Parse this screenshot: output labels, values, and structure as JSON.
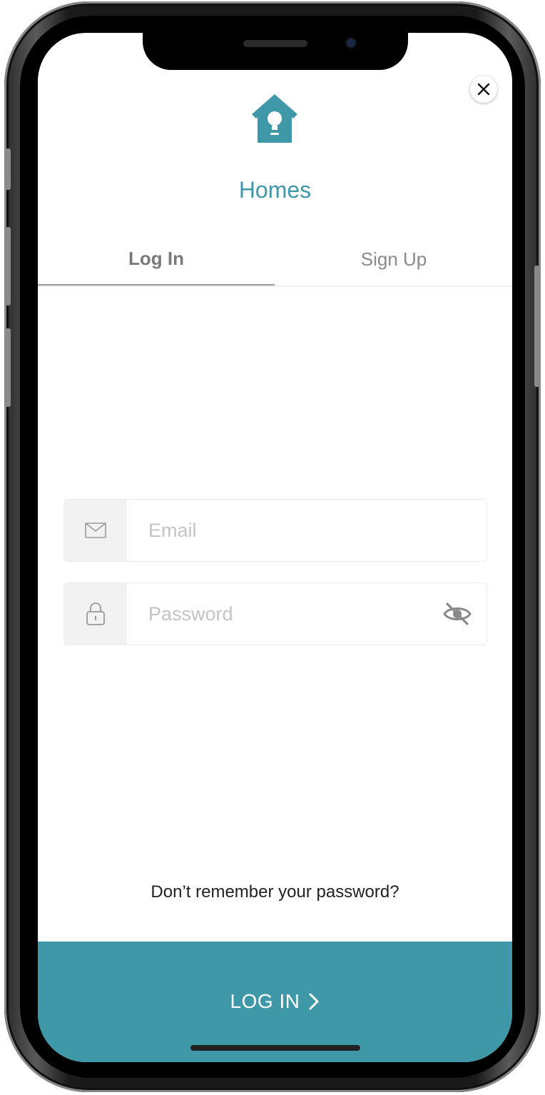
{
  "app": {
    "title": "Homes",
    "accent_color": "#3f98a8"
  },
  "tabs": [
    {
      "label": "Log In",
      "active": true
    },
    {
      "label": "Sign Up",
      "active": false
    }
  ],
  "form": {
    "email": {
      "placeholder": "Email",
      "value": "",
      "icon": "mail-icon"
    },
    "password": {
      "placeholder": "Password",
      "value": "",
      "icon": "lock-icon",
      "toggle_icon": "eye-off-icon"
    }
  },
  "forgot_password": "Don’t remember your password?",
  "login_button": {
    "label": "LOG IN"
  }
}
